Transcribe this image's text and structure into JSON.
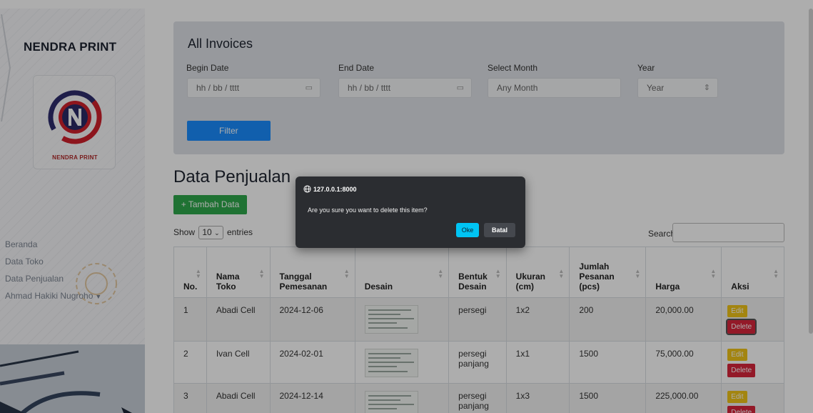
{
  "sidebar": {
    "brand": "NENDRA PRINT",
    "logo_text": "NENDRA PRINT",
    "nav": [
      {
        "label": "Beranda"
      },
      {
        "label": "Data Toko"
      },
      {
        "label": "Data Penjualan"
      },
      {
        "label": "Ahmad Hakiki Nugroho"
      }
    ]
  },
  "filter": {
    "title": "All Invoices",
    "begin_label": "Begin Date",
    "begin_value": "hh / bb / tttt",
    "end_label": "End Date",
    "end_value": "hh / bb / tttt",
    "month_label": "Select Month",
    "month_value": "Any Month",
    "year_label": "Year",
    "year_placeholder": "Year",
    "filter_button": "Filter"
  },
  "sales": {
    "title": "Data Penjualan",
    "add_button": "+ Tambah Data",
    "show_prefix": "Show",
    "entries_value": "10",
    "show_suffix": "entries",
    "search_label": "Search:",
    "columns": [
      {
        "line1": "",
        "line2": "No."
      },
      {
        "line1": "Nama",
        "line2": "Toko"
      },
      {
        "line1": "Tanggal",
        "line2": "Pemesanan"
      },
      {
        "line1": "",
        "line2": "Desain"
      },
      {
        "line1": "Bentuk",
        "line2": "Desain"
      },
      {
        "line1": "Ukuran",
        "line2": "(cm)"
      },
      {
        "line1": "Jumlah Pesanan",
        "line2": "(pcs)"
      },
      {
        "line1": "",
        "line2": "Harga"
      },
      {
        "line1": "",
        "line2": "Aksi"
      }
    ],
    "rows": [
      {
        "no": "1",
        "toko": "Abadi Cell",
        "tanggal": "2024-12-06",
        "bentuk": "persegi",
        "ukuran": "1x2",
        "jumlah": "200",
        "harga": "20,000.00"
      },
      {
        "no": "2",
        "toko": "Ivan Cell",
        "tanggal": "2024-02-01",
        "bentuk": "persegi panjang",
        "ukuran": "1x1",
        "jumlah": "1500",
        "harga": "75,000.00"
      },
      {
        "no": "3",
        "toko": "Abadi Cell",
        "tanggal": "2024-12-14",
        "bentuk": "persegi panjang",
        "ukuran": "1x3",
        "jumlah": "1500",
        "harga": "225,000.00"
      }
    ],
    "edit_label": "Edit",
    "delete_label": "Delete"
  },
  "dialog": {
    "origin": "127.0.0.1:8000",
    "message": "Are you sure you want to delete this item?",
    "ok_label": "Oke",
    "cancel_label": "Batal"
  }
}
